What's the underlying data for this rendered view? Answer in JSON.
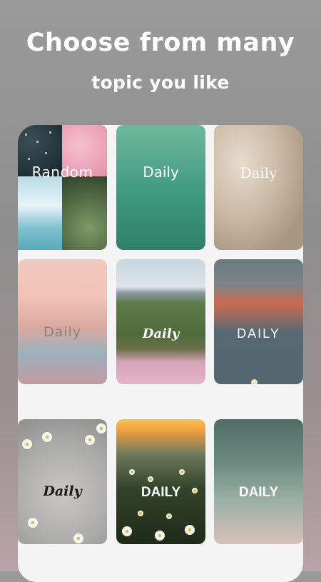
{
  "headline": {
    "line1": "Choose from many",
    "line2": "topic you like"
  },
  "topics": [
    {
      "label": "Random"
    },
    {
      "label": "Daily"
    },
    {
      "label": "Daily"
    },
    {
      "label": "Daily"
    },
    {
      "label": "Daily"
    },
    {
      "label": "DAILY"
    },
    {
      "label": "Daily"
    },
    {
      "label": "DAILY"
    },
    {
      "label": "DAILY"
    }
  ],
  "colors": {
    "background": "#9a9a9a",
    "text": "#ffffff"
  }
}
